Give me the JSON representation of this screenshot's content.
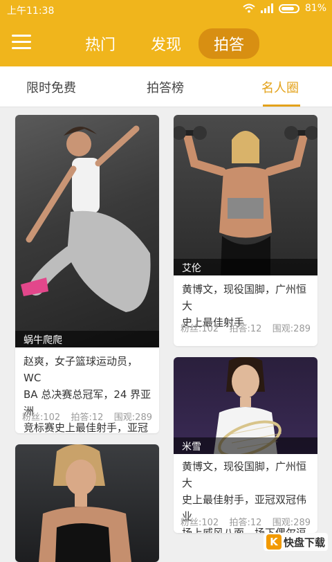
{
  "status_bar": {
    "time": "上午11:38",
    "battery": "81%"
  },
  "top_nav": {
    "tabs": [
      "热门",
      "发现",
      "拍答"
    ],
    "active": "拍答"
  },
  "sub_tabs": {
    "tabs": [
      "限时免费",
      "拍答榜",
      "名人圈"
    ],
    "active": "名人圈"
  },
  "cards": [
    {
      "name": "蜗牛爬爬",
      "description": [
        "赵爽，女子篮球运动员，WC",
        "BA 总决赛总冠军，24 界亚洲",
        "竞标赛史上最佳射手，亚冠双"
      ],
      "fans": "粉丝:102",
      "answers": "拍答:12",
      "views": "围观:289"
    },
    {
      "name": "艾伦",
      "description": [
        "黄博文，现役国脚，广州恒大",
        "史上最佳射手"
      ],
      "fans": "粉丝:102",
      "answers": "拍答:12",
      "views": "围观:289"
    },
    {
      "name": "米雪",
      "description": [
        "黄博文，现役国脚，广州恒大",
        "史上最佳射手，亚冠双冠伟业",
        "场上威风八面，场下偶尔逗比"
      ],
      "fans": "粉丝:102",
      "answers": "拍答:12",
      "views": "围观:289"
    }
  ],
  "watermark": {
    "logo": "K",
    "text": "快盘下载"
  },
  "colors": {
    "accent": "#f0b51c",
    "active_pill": "#d88f12",
    "tab_active": "#e3a21a"
  }
}
